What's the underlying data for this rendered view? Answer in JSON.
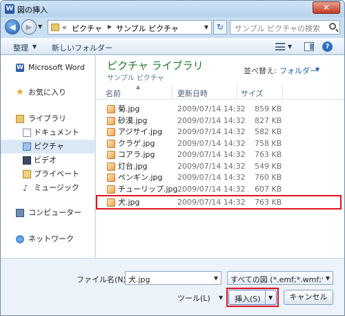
{
  "window": {
    "title": "図の挿入",
    "app_icon": "W",
    "close_glyph": "✕"
  },
  "nav": {
    "back_glyph": "◀",
    "forward_glyph": "▶",
    "address": {
      "chevron": "«",
      "crumbs": [
        "ピクチャ",
        "サンプル ピクチャ"
      ],
      "separator": "▶"
    },
    "refresh_glyph": "↻",
    "search_placeholder": "サンプル ピクチャの検索"
  },
  "toolbar": {
    "organize": "整理",
    "new_folder": "新しいフォルダー"
  },
  "sidebar": {
    "items": [
      {
        "label": "Microsoft Word",
        "icon": "word-icon"
      },
      {
        "label": "お気に入り",
        "icon": "star-icon"
      },
      {
        "label": "ライブラリ",
        "icon": "library-icon"
      },
      {
        "label": "ドキュメント",
        "icon": "document-icon"
      },
      {
        "label": "ピクチャ",
        "icon": "picture-icon"
      },
      {
        "label": "ビデオ",
        "icon": "video-icon"
      },
      {
        "label": "プライベート",
        "icon": "folder-icon"
      },
      {
        "label": "ミュージック",
        "icon": "music-icon"
      },
      {
        "label": "コンピューター",
        "icon": "computer-icon"
      },
      {
        "label": "ネットワーク",
        "icon": "network-icon"
      }
    ],
    "selected": "ピクチャ"
  },
  "library": {
    "title": "ピクチャ ライブラリ",
    "subtitle": "サンプル ピクチャ",
    "sort_label": "並べ替え:",
    "sort_value": "フォルダー"
  },
  "columns": {
    "name": "名前",
    "date": "更新日時",
    "size": "サイズ"
  },
  "files": [
    {
      "name": "菊.jpg",
      "date": "2009/07/14 14:32",
      "size": "859 KB"
    },
    {
      "name": "砂漠.jpg",
      "date": "2009/07/14 14:32",
      "size": "827 KB"
    },
    {
      "name": "アジサイ.jpg",
      "date": "2009/07/14 14:32",
      "size": "582 KB"
    },
    {
      "name": "クラゲ.jpg",
      "date": "2009/07/14 14:32",
      "size": "758 KB"
    },
    {
      "name": "コアラ.jpg",
      "date": "2009/07/14 14:32",
      "size": "763 KB"
    },
    {
      "name": "灯台.jpg",
      "date": "2009/07/14 14:32",
      "size": "549 KB"
    },
    {
      "name": "ペンギン.jpg",
      "date": "2009/07/14 14:32",
      "size": "760 KB"
    },
    {
      "name": "チューリップ.jpg",
      "date": "2009/07/14 14:32",
      "size": "607 KB"
    },
    {
      "name": "犬.jpg",
      "date": "2009/07/14 14:32",
      "size": "763 KB"
    }
  ],
  "highlighted_file": "犬.jpg",
  "bottom": {
    "filename_label": "ファイル名(N):",
    "filename_value": "犬.jpg",
    "filter_value": "すべての図 (*.emf;*.wmf;*.j",
    "tools_label": "ツール(L)",
    "insert_label": "挿入(S)",
    "cancel_label": "キャンセル"
  },
  "colors": {
    "accent": "#1a5fb4",
    "library_title": "#1c7a2a",
    "highlight": "#e0101c"
  }
}
